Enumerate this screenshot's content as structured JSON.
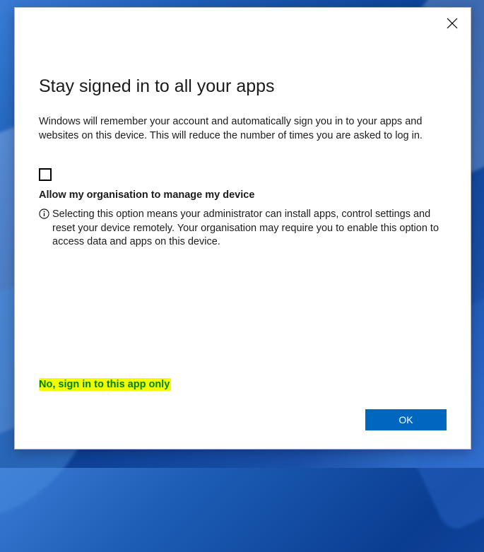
{
  "dialog": {
    "title": "Stay signed in to all your apps",
    "description": "Windows will remember your account and automatically sign you in to your apps and websites on this device. This will reduce the number of times you are asked to log in.",
    "checkbox_label": "Allow my organisation to manage my device",
    "info_text": "Selecting this option means your administrator can install apps, control settings and reset your device remotely. Your organisation may require you to enable this option to access data and apps on this device.",
    "link_text": "No, sign in to this app only",
    "ok_label": "OK"
  }
}
